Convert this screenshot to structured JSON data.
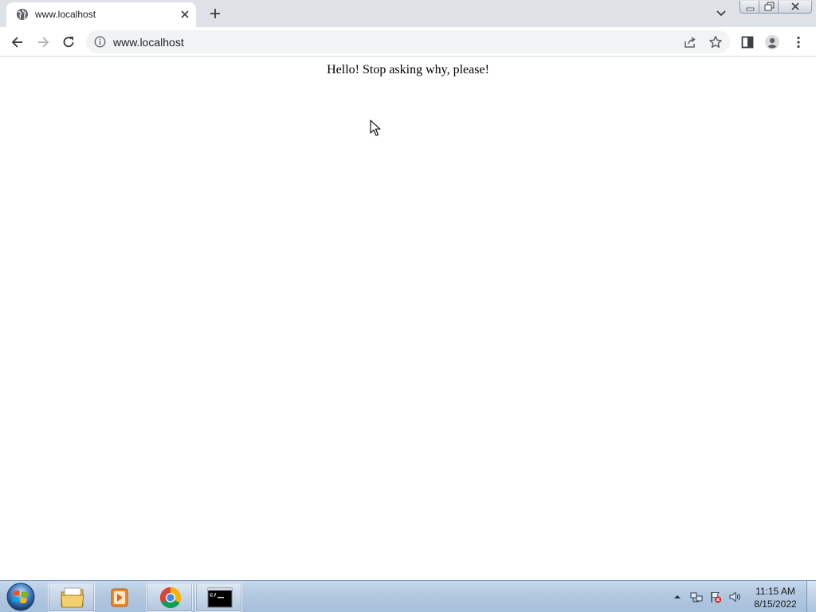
{
  "browser": {
    "tab": {
      "title": "www.localhost",
      "favicon": "globe-icon",
      "close_icon": "close-icon"
    },
    "new_tab_icon": "plus-icon",
    "tab_search_icon": "chevron-down-icon",
    "window_controls": [
      "minimize-icon",
      "restore-icon",
      "close-icon"
    ],
    "toolbar": {
      "back_icon": "arrow-left-icon",
      "forward_icon": "arrow-right-icon",
      "reload_icon": "reload-icon",
      "omnibox": {
        "info_icon": "info-icon",
        "url": "www.localhost"
      },
      "share_icon": "share-icon",
      "bookmark_icon": "star-icon",
      "side_panel_icon": "side-panel-icon",
      "profile_icon": "profile-icon",
      "menu_icon": "kebab-menu-icon"
    }
  },
  "page": {
    "text": "Hello! Stop asking why, please!"
  },
  "taskbar": {
    "start_icon": "windows-start-orb-icon",
    "apps": [
      "file-explorer-icon",
      "media-player-icon",
      "chrome-icon",
      "command-prompt-icon"
    ],
    "tray_icons": [
      "show-hidden-icons-chevron",
      "network-icon",
      "action-center-flag-icon",
      "volume-icon"
    ],
    "clock": {
      "time": "11:15 AM",
      "date": "8/15/2022"
    }
  },
  "colors": {
    "tab_strip": "#dee1e6",
    "omnibox": "#f1f3f4",
    "taskbar": "#b2c8e0"
  }
}
